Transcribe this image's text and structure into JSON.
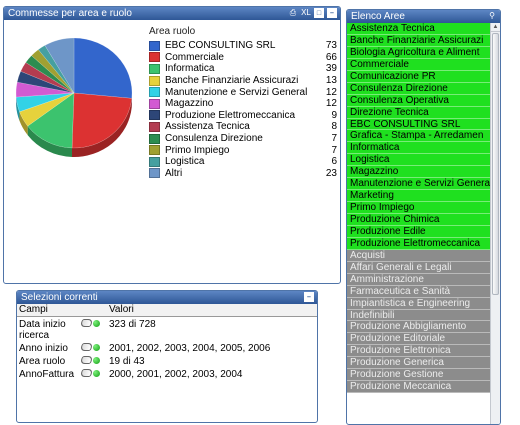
{
  "chart_panel": {
    "title": "Commesse per area e ruolo",
    "icons": [
      "print-icon",
      "xl-icon",
      "detach-icon",
      "minimize-icon"
    ]
  },
  "chart_data": {
    "type": "pie",
    "legend_title": "Area ruolo",
    "slices": [
      {
        "label": "EBC CONSULTING SRL",
        "value": 73,
        "color": "#3366cc"
      },
      {
        "label": "Commerciale",
        "value": 66,
        "color": "#dc3232"
      },
      {
        "label": "Informatica",
        "value": 39,
        "color": "#3cc36e"
      },
      {
        "label": "Banche  Finanziarie Assicurazi",
        "value": 13,
        "color": "#e6d23c"
      },
      {
        "label": "Manutenzione e Servizi General",
        "value": 12,
        "color": "#32d2e6"
      },
      {
        "label": "Magazzino",
        "value": 12,
        "color": "#d25ad2"
      },
      {
        "label": "Produzione Elettromeccanica",
        "value": 9,
        "color": "#2d4678"
      },
      {
        "label": "Assistenza Tecnica",
        "value": 8,
        "color": "#b43c50"
      },
      {
        "label": "Consulenza Direzione",
        "value": 7,
        "color": "#2d8c50"
      },
      {
        "label": "Primo Impiego",
        "value": 7,
        "color": "#a0a032"
      },
      {
        "label": "Logistica",
        "value": 6,
        "color": "#46a0a0"
      },
      {
        "label": "Altri",
        "value": 23,
        "color": "#6e96c8"
      }
    ]
  },
  "selections_panel": {
    "title": "Selezioni correnti",
    "col_fields": "Campi",
    "col_values": "Valori",
    "rows": [
      {
        "field": "Data inizio ricerca",
        "value": "323 di 728"
      },
      {
        "field": "Anno inizio",
        "value": "2001, 2002, 2003, 2004, 2005, 2006"
      },
      {
        "field": "Area ruolo",
        "value": "19 di 43"
      },
      {
        "field": "AnnoFattura",
        "value": "2000, 2001, 2002, 2003, 2004"
      }
    ]
  },
  "list_panel": {
    "title": "Elenco Aree",
    "selected_color": "#1fe01f",
    "excluded_color": "#8c8c8c",
    "items": [
      {
        "label": "Assistenza Tecnica",
        "state": "selected"
      },
      {
        "label": "Banche  Finanziarie Assicurazi",
        "state": "selected"
      },
      {
        "label": "Biologia Agricoltura e Aliment",
        "state": "selected"
      },
      {
        "label": "Commerciale",
        "state": "selected"
      },
      {
        "label": "Comunicazione PR",
        "state": "selected"
      },
      {
        "label": "Consulenza Direzione",
        "state": "selected"
      },
      {
        "label": "Consulenza Operativa",
        "state": "selected"
      },
      {
        "label": "Direzione Tecnica",
        "state": "selected"
      },
      {
        "label": "EBC CONSULTING SRL",
        "state": "selected"
      },
      {
        "label": "Grafica - Stampa  -  Arredamen",
        "state": "selected"
      },
      {
        "label": "Informatica",
        "state": "selected"
      },
      {
        "label": "Logistica",
        "state": "selected"
      },
      {
        "label": "Magazzino",
        "state": "selected"
      },
      {
        "label": "Manutenzione e Servizi General",
        "state": "selected"
      },
      {
        "label": "Marketing",
        "state": "selected"
      },
      {
        "label": "Primo Impiego",
        "state": "selected"
      },
      {
        "label": "Produzione Chimica",
        "state": "selected"
      },
      {
        "label": "Produzione Edile",
        "state": "selected"
      },
      {
        "label": "Produzione Elettromeccanica",
        "state": "selected"
      },
      {
        "label": "Acquisti",
        "state": "excluded"
      },
      {
        "label": "Affari Generali e Legali",
        "state": "excluded"
      },
      {
        "label": "Amministrazione",
        "state": "excluded"
      },
      {
        "label": "Farmaceutica e Sanità",
        "state": "excluded"
      },
      {
        "label": "Impiantistica e Engineering",
        "state": "excluded"
      },
      {
        "label": "Indefinibili",
        "state": "excluded"
      },
      {
        "label": "Produzione Abbigliamento",
        "state": "excluded"
      },
      {
        "label": "Produzione Editoriale",
        "state": "excluded"
      },
      {
        "label": "Produzione Elettronica",
        "state": "excluded"
      },
      {
        "label": "Produzione Generica",
        "state": "excluded"
      },
      {
        "label": "Produzione Gestione",
        "state": "excluded"
      },
      {
        "label": "Produzione Meccanica",
        "state": "excluded"
      }
    ]
  }
}
